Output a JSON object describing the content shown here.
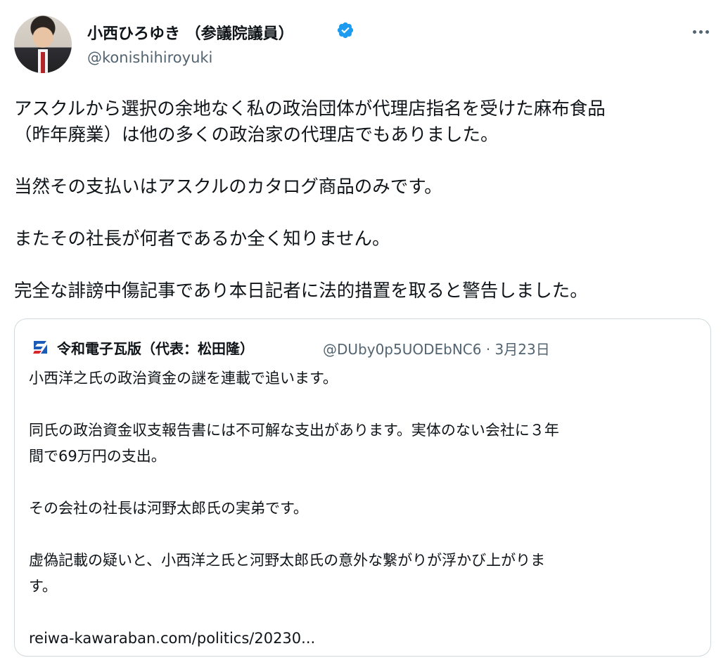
{
  "author": {
    "display_name": "小西ひろゆき （参議院議員）",
    "handle": "@konishihiroyuki",
    "verified_color": "#1d9bf0"
  },
  "tweet": {
    "lines": [
      "アスクルから選択の余地なく私の政治団体が代理店指名を受けた麻布食品",
      "（昨年廃業）は他の多くの政治家の代理店でもありました。",
      "当然その支払いはアスクルのカタログ商品のみです。",
      "またその社長が何者であるか全く知りません。",
      "完全な誹謗中傷記事であり本日記者に法的措置を取ると警告しました。"
    ]
  },
  "quote": {
    "display_name": "令和電子瓦版（代表：松田隆）",
    "meta": "@DUby0p5UODEbNC6 · 3月23日",
    "logo_color": "#1d5bb8",
    "lines": [
      "小西洋之氏の政治資金の謎を連載で追います。",
      "同氏の政治資金収支報告書には不可解な支出があります。実体のない会社に３年",
      "間で69万円の支出。",
      "その会社の社長は河野太郎氏の実弟です。",
      "虚偽記載の疑いと、小西洋之氏と河野太郎氏の意外な繋がりが浮かび上がりま",
      "す。",
      "reiwa-kawaraban.com/politics/20230..."
    ]
  }
}
